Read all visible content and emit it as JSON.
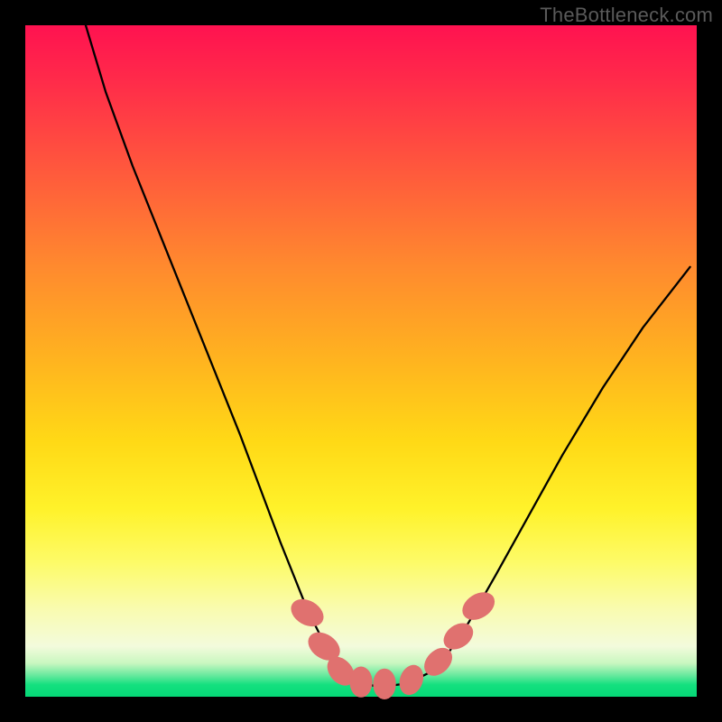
{
  "watermark": "TheBottleneck.com",
  "chart_data": {
    "type": "line",
    "title": "",
    "xlabel": "",
    "ylabel": "",
    "xlim": [
      0,
      100
    ],
    "ylim": [
      0,
      100
    ],
    "series": [
      {
        "name": "curve",
        "x": [
          9,
          12,
          16,
          20,
          24,
          28,
          32,
          35,
          38,
          40,
          42,
          44,
          46,
          48,
          50,
          52,
          54,
          57,
          60,
          63,
          66,
          70,
          75,
          80,
          86,
          92,
          99
        ],
        "y": [
          100,
          90,
          79,
          69,
          59,
          49,
          39,
          31,
          23,
          18,
          13,
          9,
          6,
          3.5,
          2.2,
          1.6,
          1.6,
          2.0,
          3.5,
          6.5,
          11,
          18,
          27,
          36,
          46,
          55,
          64
        ],
        "color": "#000000",
        "width": 2.3
      }
    ],
    "markers": [
      {
        "cx": 42.0,
        "cy": 12.5,
        "rx": 1.8,
        "ry": 2.6,
        "rot": -60
      },
      {
        "cx": 44.5,
        "cy": 7.5,
        "rx": 1.8,
        "ry": 2.6,
        "rot": -55
      },
      {
        "cx": 47.0,
        "cy": 3.8,
        "rx": 1.7,
        "ry": 2.4,
        "rot": -40
      },
      {
        "cx": 50.0,
        "cy": 2.2,
        "rx": 1.7,
        "ry": 2.3,
        "rot": 0
      },
      {
        "cx": 53.5,
        "cy": 1.9,
        "rx": 1.7,
        "ry": 2.3,
        "rot": 0
      },
      {
        "cx": 57.5,
        "cy": 2.5,
        "rx": 1.7,
        "ry": 2.3,
        "rot": 20
      },
      {
        "cx": 61.5,
        "cy": 5.2,
        "rx": 1.7,
        "ry": 2.4,
        "rot": 45
      },
      {
        "cx": 64.5,
        "cy": 9.0,
        "rx": 1.7,
        "ry": 2.4,
        "rot": 55
      },
      {
        "cx": 67.5,
        "cy": 13.5,
        "rx": 1.8,
        "ry": 2.6,
        "rot": 58
      }
    ],
    "marker_color": "#e0716f",
    "gradient_stops": [
      {
        "pos": 0,
        "color": "#ff1250"
      },
      {
        "pos": 50,
        "color": "#ffb41f"
      },
      {
        "pos": 80,
        "color": "#fdfb68"
      },
      {
        "pos": 98,
        "color": "#14e07f"
      },
      {
        "pos": 100,
        "color": "#05d876"
      }
    ]
  }
}
